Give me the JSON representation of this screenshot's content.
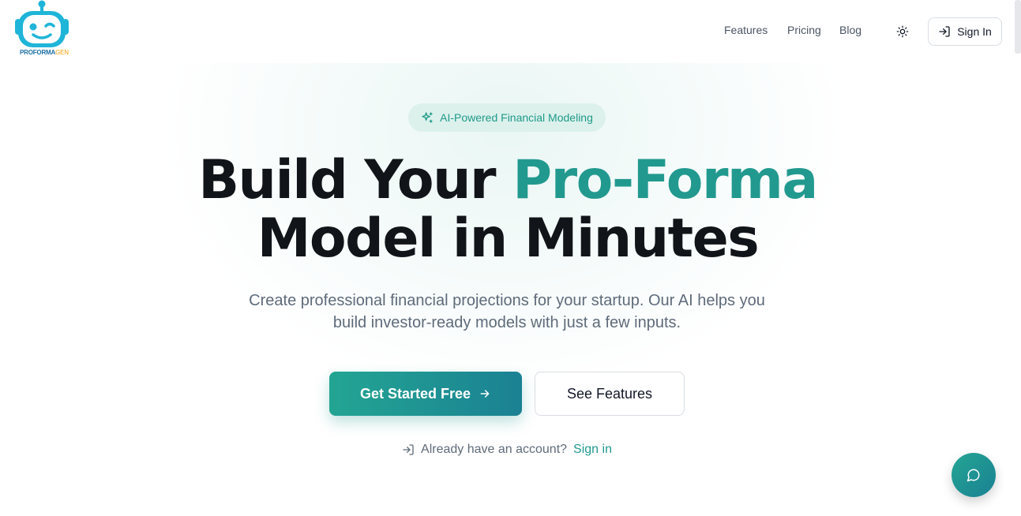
{
  "brand": {
    "logo_text_a": "PROFORMA",
    "logo_text_b": "GEN"
  },
  "nav": {
    "features": "Features",
    "pricing": "Pricing",
    "blog": "Blog",
    "theme_toggle_icon": "sun-icon",
    "sign_in": "Sign In"
  },
  "hero": {
    "badge": "AI-Powered Financial Modeling",
    "headline_part1": "Build Your ",
    "headline_accent": "Pro-Forma",
    "headline_part2": "Model in Minutes",
    "subtitle": "Create professional financial projections for your startup. Our AI helps you build investor-ready models with just a few inputs.",
    "primary_cta": "Get Started Free",
    "secondary_cta": "See Features",
    "account_prompt": "Already have an account?",
    "account_link": "Sign in"
  },
  "colors": {
    "accent": "#22998f",
    "badge_bg": "#dcf1ec",
    "logo_blue": "#1fb5d8"
  },
  "chat": {
    "icon": "chat-bubble-icon"
  }
}
